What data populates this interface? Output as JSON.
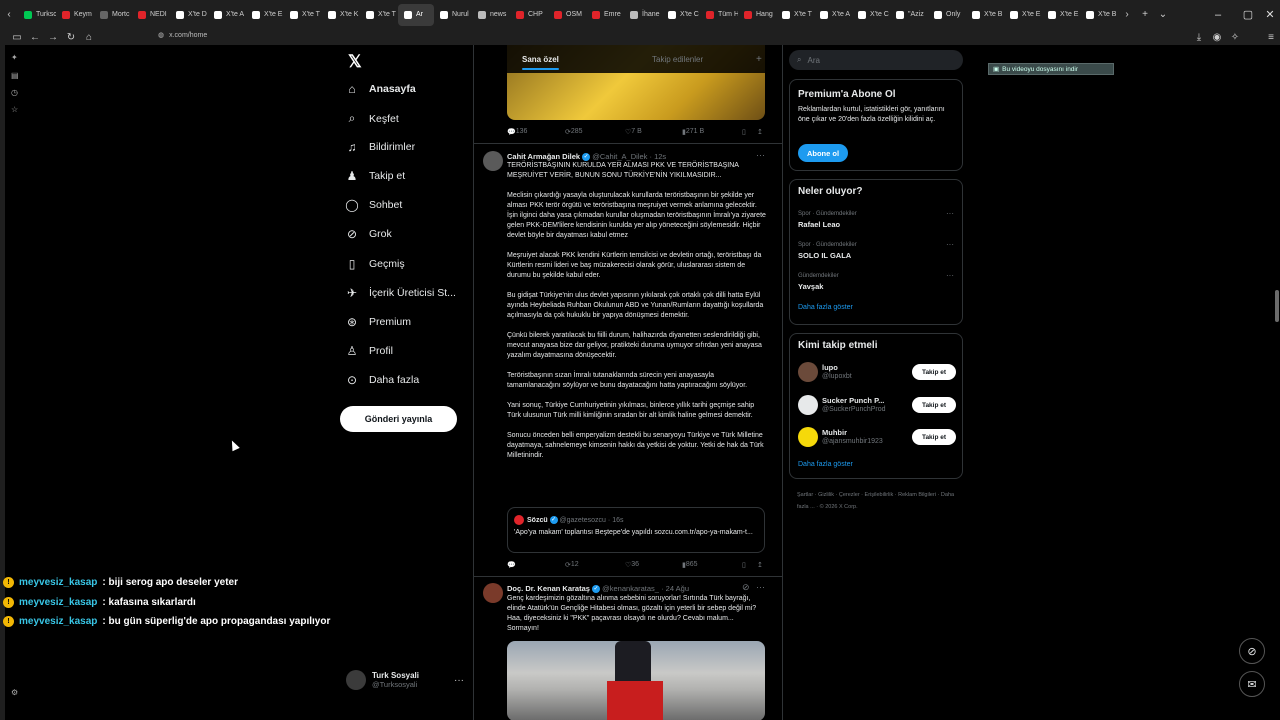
{
  "browser": {
    "tabs": [
      {
        "label": "Turksc",
        "color": "#00c853"
      },
      {
        "label": "Keym",
        "color": "#e0242a"
      },
      {
        "label": "Mortc",
        "color": "#666666"
      },
      {
        "label": "NEDI",
        "color": "#e0242a"
      },
      {
        "label": "X'te D",
        "color": "#ffffff"
      },
      {
        "label": "X'te A",
        "color": "#ffffff"
      },
      {
        "label": "X'te E",
        "color": "#ffffff"
      },
      {
        "label": "X'te T",
        "color": "#ffffff"
      },
      {
        "label": "X'te K",
        "color": "#ffffff"
      },
      {
        "label": "X'te T",
        "color": "#ffffff"
      },
      {
        "label": "Ar",
        "color": "#ffffff"
      },
      {
        "label": "Nurul",
        "color": "#ffffff"
      },
      {
        "label": "news",
        "color": "#bbbbbb"
      },
      {
        "label": "CHP",
        "color": "#e0242a"
      },
      {
        "label": "OSM",
        "color": "#e0242a"
      },
      {
        "label": "Emre",
        "color": "#e0242a"
      },
      {
        "label": "İhane",
        "color": "#bbbbbb"
      },
      {
        "label": "X'te C",
        "color": "#ffffff"
      },
      {
        "label": "Tüm H",
        "color": "#e0242a"
      },
      {
        "label": "Hang",
        "color": "#e0242a"
      },
      {
        "label": "X'te T",
        "color": "#ffffff"
      },
      {
        "label": "X'te A",
        "color": "#ffffff"
      },
      {
        "label": "X'te C",
        "color": "#ffffff"
      },
      {
        "label": "\"Aziz",
        "color": "#ffffff"
      },
      {
        "label": "Only",
        "color": "#ffffff"
      },
      {
        "label": "X'te B",
        "color": "#ffffff"
      },
      {
        "label": "X'te E",
        "color": "#ffffff"
      },
      {
        "label": "X'te E",
        "color": "#ffffff"
      },
      {
        "label": "X'te B",
        "color": "#ffffff"
      }
    ],
    "url": "x.com/home"
  },
  "nav": {
    "items": [
      {
        "label": "Anasayfa",
        "icon": "home-icon",
        "glyph": "⌂"
      },
      {
        "label": "Keşfet",
        "icon": "search-icon",
        "glyph": "⌕"
      },
      {
        "label": "Bildirimler",
        "icon": "bell-icon",
        "glyph": "♫"
      },
      {
        "label": "Takip et",
        "icon": "follow-icon",
        "glyph": "♟"
      },
      {
        "label": "Sohbet",
        "icon": "chat-icon",
        "glyph": "◯"
      },
      {
        "label": "Grok",
        "icon": "grok-icon",
        "glyph": "⊘"
      },
      {
        "label": "Geçmiş",
        "icon": "bookmark-icon",
        "glyph": "▯"
      },
      {
        "label": "İçerik Üreticisi St...",
        "icon": "creator-icon",
        "glyph": "✈"
      },
      {
        "label": "Premium",
        "icon": "premium-icon",
        "glyph": "⊛"
      },
      {
        "label": "Profil",
        "icon": "profile-icon",
        "glyph": "♙"
      },
      {
        "label": "Daha fazla",
        "icon": "more-icon",
        "glyph": "⊙"
      }
    ],
    "post_button": "Gönderi yayınla",
    "account_name": "Turk Sosyali",
    "account_handle": "@Turksosyali"
  },
  "feed": {
    "tab_for_you": "Sana özel",
    "tab_following": "Takip edilenler",
    "first_actions": {
      "replies": "136",
      "reposts": "285",
      "likes": "7 B",
      "views": "271 B"
    },
    "tweet1": {
      "name": "Cahit Armağan Dilek",
      "handle": "@Cahit_A_Dilek",
      "time": "12s",
      "paragraphs": [
        "TERÖRİSTBAŞININ KURULDA YER ALMASI PKK VE TERÖRİSTBAŞINA MEŞRUİYET VERİR, BUNUN SONU TÜRKİYE'NİN YIKILMASIDIR...",
        "Meclisin çıkardığı yasayla oluşturulacak kurullarda teröristbaşının bir şekilde yer alması PKK terör örgütü ve teröristbaşına meşruiyet vermek anlamına gelecektir.\nİşin ilginci daha yasa çıkmadan kurullar oluşmadan teröristbaşının İmralı'ya ziyarete gelen PKK-DEM'lilere kendisinin kurulda yer alıp yöneteceğini söylemesidir. Hiçbir devlet böyle bir dayatması kabul etmez",
        "Meşruiyet alacak PKK kendini Kürtlerin temsilcisi ve devletin ortağı, teröristbaşı da Kürtlerin resmi lideri ve baş müzakerecisi olarak görür, uluslararası sistem de durumu bu şekilde kabul eder.",
        "Bu gidişat Türkiye'nin ulus devlet yapısının yıkılarak çok ortaklı çok dilli hatta Eylül ayında Heybeliada Ruhban Okulunun ABD ve Yunan/Rumların dayattığı koşullarda açılmasıyla da çok hukuklu bir yapıya dönüşmesi demektir.",
        "Çünkü bilerek yaratılacak bu fiilli durum, halihazırda diyanetten seslendirildiği gibi, mevcut anayasa bize dar geliyor, pratikteki duruma uymuyor sıfırdan yeni anayasa yazalım dayatmasına dönüşecektir.",
        "Teröristbaşının sızan İmralı tutanaklarında sürecin yeni anayasayla tamamlanacağını söylüyor ve bunu dayatacağını hatta yaptıracağını söylüyor.",
        "Yani sonuç, Türkiye Cumhuriyetinin yıkılması, binlerce yıllık tarihi geçmişe sahip Türk ulusunun Türk milli kimliğinin sıradan bir alt kimlik haline gelmesi demektir.",
        "Sonucu önceden belli emperyalizm destekli bu senaryoyu Türkiye ve Türk Milletine dayatmaya, sahnelemeye kimsenin hakkı da yetkisi de yoktur. Yetki de hak da Türk Milletinindir."
      ],
      "quote": {
        "name": "Sözcü",
        "handle": "@gazetesozcu",
        "time": "16s",
        "text": "'Apo'ya makam' toplantısı Beştepe'de yapıldı sozcu.com.tr/apo-ya-makam-t..."
      },
      "actions": {
        "replies": "",
        "reposts": "12",
        "likes": "36",
        "views": "865"
      }
    },
    "tweet2": {
      "name": "Doç. Dr. Kenan Karataş",
      "handle": "@kenankaratas_",
      "time": "24 Ağu",
      "text": "Genç kardeşimizin gözaltına alınma sebebini soruyorlar! Sırtında Türk bayrağı, elinde Atatürk'ün Gençliğe Hitabesi olması, gözaltı için yeterli bir sebep değil mi? Haa, diyeceksiniz ki \"PKK\" paçavrası olsaydı ne olurdu? Cevabı malum... Sormayın!"
    }
  },
  "sidebar": {
    "search_placeholder": "Ara",
    "premium": {
      "title": "Premium'a Abone Ol",
      "desc": "Reklamlardan kurtul, istatistikleri gör, yanıtlarını öne çıkar ve 20'den fazla özelliğin kilidini aç.",
      "button": "Abone ol"
    },
    "trends_title": "Neler oluyor?",
    "trends": [
      {
        "cat": "Spor · Gündemdekiler",
        "name": "Rafael Leao"
      },
      {
        "cat": "Spor · Gündemdekiler",
        "name": "SOLO IL GALA"
      },
      {
        "cat": "Gündemdekiler",
        "name": "Yavşak"
      }
    ],
    "show_more": "Daha fazla göster",
    "who_title": "Kimi takip etmeli",
    "who": [
      {
        "name": "lupo",
        "handle": "@lupoxbt",
        "avatar": "#6b4a3a"
      },
      {
        "name": "Sucker Punch P...",
        "handle": "@SuckerPunchProd",
        "avatar": "#e7e9ea"
      },
      {
        "name": "Muhbir",
        "handle": "@ajansmuhbir1923",
        "avatar": "#f5d90a"
      }
    ],
    "follow_label": "Takip et",
    "footer": "Şartlar · Gizlilik · Çerezler · Erişilebilirlik · Reklam Bilgileri · Daha fazla ... · © 2026 X Corp."
  },
  "download_banner": "Bu videoyu dosyasını indir",
  "chat": [
    {
      "user": "meyvesiz_kasap",
      "msg": ": biji serog apo deseler yeter"
    },
    {
      "user": "meyvesiz_kasap",
      "msg": ": kafasına sıkarlardı"
    },
    {
      "user": "meyvesiz_kasap",
      "msg": ": bu gün süperlig'de apo propagandası yapılıyor"
    }
  ],
  "colors": {
    "accent": "#1d9bf0",
    "chat_user": "#39c6e6",
    "badge": "#f2b705"
  }
}
